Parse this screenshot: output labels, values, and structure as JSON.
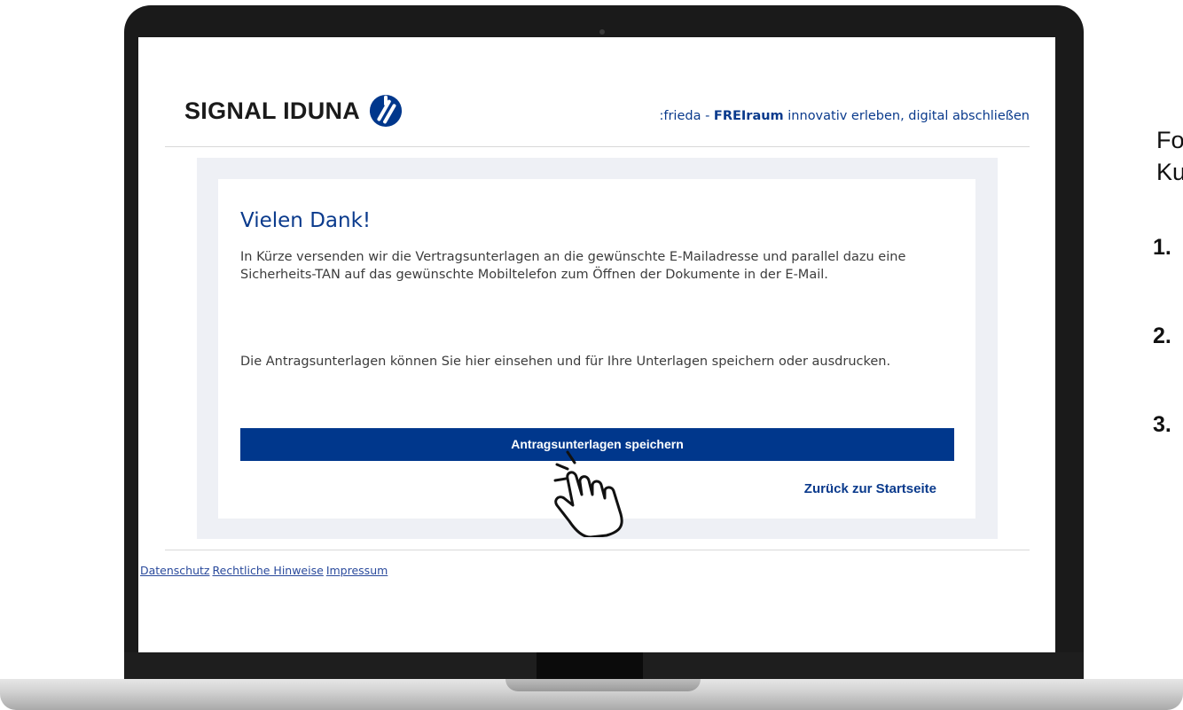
{
  "brand": {
    "name": "SIGNAL IDUNA",
    "colors": {
      "primary": "#00378c",
      "text": "#3c3c3c",
      "panel": "#eef0f5"
    }
  },
  "header": {
    "tagline_prefix": ":frieda - ",
    "tagline_bold": "FREIraum",
    "tagline_suffix": " innovativ erleben, digital abschließen"
  },
  "confirmation": {
    "title": "Vielen Dank!",
    "message": "In Kürze versenden wir die Vertragsunterlagen an die gewünschte E-Mailadresse und parallel dazu eine Sicherheits-TAN auf das gewünschte Mobiltelefon zum Öffnen der Dokumente in der E-Mail.",
    "documents_text": "Die Antragsunterlagen können Sie hier einsehen und für Ihre Unterlagen speichern oder ausdrucken.",
    "save_button": "Antragsunterlagen speichern",
    "back_link": "Zurück zur Startseite"
  },
  "footer": {
    "links": [
      "Datenschutz",
      "Rechtliche Hinweise",
      "Impressum"
    ]
  },
  "side_panel": {
    "intro_line1": "Folg",
    "intro_line2": "Kun",
    "steps": [
      "1.",
      "2.",
      "3."
    ]
  },
  "icons": {
    "logo": "signal-iduna-logo-icon",
    "cursor": "hand-pointer-icon"
  }
}
